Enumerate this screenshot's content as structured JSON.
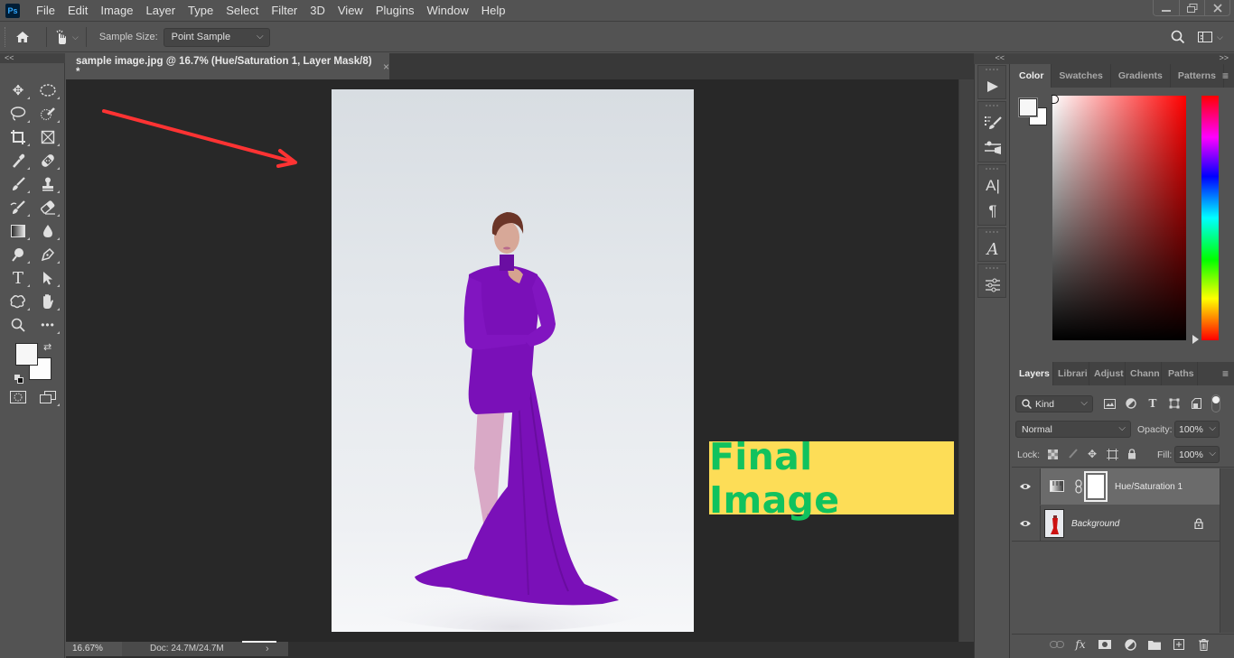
{
  "app": {
    "logo": "Ps",
    "menu": [
      "File",
      "Edit",
      "Image",
      "Layer",
      "Type",
      "Select",
      "Filter",
      "3D",
      "View",
      "Plugins",
      "Window",
      "Help"
    ],
    "window_controls": {
      "minimize": "minimize-icon",
      "restore": "restore-icon",
      "close": "close-icon"
    }
  },
  "options_bar": {
    "home_icon": "home-icon",
    "tool_icon": "hand-pointer-icon",
    "sample_size_label": "Sample Size:",
    "sample_size_value": "Point Sample",
    "search_icon": "search-icon",
    "workspace_icon": "workspace-icon"
  },
  "toolbar": {
    "collapse": "<<",
    "tools": [
      {
        "name": "move-tool",
        "glyph": "✥"
      },
      {
        "name": "marquee-tool",
        "glyph": "◌"
      },
      {
        "name": "lasso-tool",
        "glyph": "➰"
      },
      {
        "name": "quick-select-tool",
        "glyph": "✎"
      },
      {
        "name": "crop-tool",
        "glyph": "⌗"
      },
      {
        "name": "frame-tool",
        "glyph": "⊠"
      },
      {
        "name": "eyedropper-tool",
        "glyph": "✒"
      },
      {
        "name": "healing-brush-tool",
        "glyph": "✚"
      },
      {
        "name": "brush-tool",
        "glyph": "🖌"
      },
      {
        "name": "clone-stamp-tool",
        "glyph": "⊥"
      },
      {
        "name": "history-brush-tool",
        "glyph": "↺"
      },
      {
        "name": "eraser-tool",
        "glyph": "⌫"
      },
      {
        "name": "gradient-tool",
        "glyph": "▦"
      },
      {
        "name": "blur-tool",
        "glyph": "💧"
      },
      {
        "name": "dodge-tool",
        "glyph": "⚲"
      },
      {
        "name": "pen-tool",
        "glyph": "✑"
      },
      {
        "name": "type-tool",
        "glyph": "T"
      },
      {
        "name": "path-selection-tool",
        "glyph": "➤"
      },
      {
        "name": "custom-shape-tool",
        "glyph": "✱"
      },
      {
        "name": "hand-tool",
        "glyph": "✋"
      },
      {
        "name": "zoom-tool",
        "glyph": "🔍"
      },
      {
        "name": "edit-toolbar",
        "glyph": "•••"
      }
    ],
    "foreground_color": "#f7f7f7",
    "background_color": "#fdfdfd",
    "swap_icon": "⇄",
    "quick_mask_icon": "◎",
    "screen_mode_icon": "⧉"
  },
  "document": {
    "tab_title": "sample image.jpg @ 16.7% (Hue/Saturation 1, Layer Mask/8) *",
    "close": "×",
    "annotation_label": "Final Image",
    "annotation_bg": "#fddd57",
    "annotation_color": "#11c25e",
    "arrow_color": "#ff3333",
    "dress_color": "#7a10b8"
  },
  "status": {
    "zoom": "16.67%",
    "doc_info": "Doc: 24.7M/24.7M",
    "arrow": "›"
  },
  "mid_dock": {
    "collapse": "<<",
    "icons": [
      "play-icon",
      "brush-settings-icon",
      "brush-presets-icon",
      "character-icon",
      "paragraph-icon",
      "glyphs-icon",
      "properties-icon"
    ]
  },
  "color_panel": {
    "collapse": ">>",
    "tabs": [
      "Color",
      "Swatches",
      "Gradients",
      "Patterns"
    ],
    "active_tab": "Color",
    "hue": "#ff0000"
  },
  "layers_panel": {
    "tabs": [
      "Layers",
      "Librari",
      "Adjust",
      "Chann",
      "Paths"
    ],
    "active_tab": "Layers",
    "filter_kind": "Kind",
    "blend_mode": "Normal",
    "opacity_label": "Opacity:",
    "opacity": "100%",
    "lock_label": "Lock:",
    "fill_label": "Fill:",
    "fill": "100%",
    "layers": [
      {
        "name": "Hue/Saturation 1",
        "type": "adjustment",
        "visible": true,
        "selected": true
      },
      {
        "name": "Background",
        "type": "image",
        "visible": true,
        "locked": true,
        "italic": true
      }
    ]
  }
}
